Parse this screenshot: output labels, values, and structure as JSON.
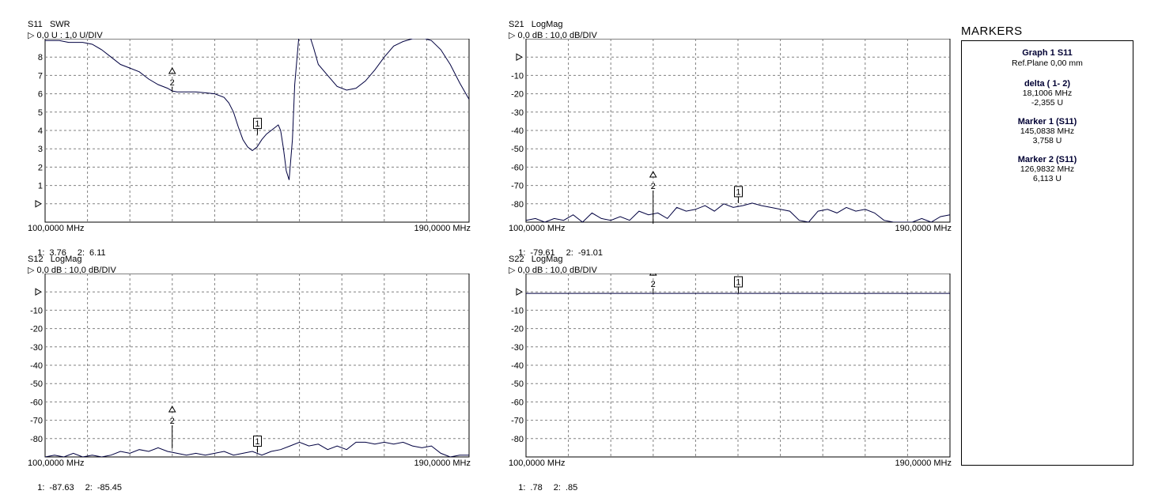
{
  "colors": {
    "trace": "#000040",
    "grid": "#808080",
    "ref_line": "#000060"
  },
  "chart_data": [
    {
      "id": "g1",
      "type": "line",
      "param": "S11",
      "format": "SWR",
      "scale_text": "0,0 U : 1,0 U/DIV",
      "x_start_label": "100,0000 MHz",
      "x_end_label": "190,0000 MHz",
      "xlim": [
        100,
        190
      ],
      "ylim": [
        -1,
        9
      ],
      "ref_value": 0,
      "y_ticks": [
        {
          "label": "8",
          "value": 8
        },
        {
          "label": "7",
          "value": 7
        },
        {
          "label": "6",
          "value": 6
        },
        {
          "label": "5",
          "value": 5
        },
        {
          "label": "4",
          "value": 4
        },
        {
          "label": "3",
          "value": 3
        },
        {
          "label": "2",
          "value": 2
        },
        {
          "label": "1",
          "value": 1
        }
      ],
      "series": [
        {
          "x": [
            100,
            103,
            105,
            108,
            110,
            112,
            114,
            116,
            118,
            120,
            122,
            124,
            126,
            127,
            128,
            130,
            132,
            134,
            136,
            138,
            139,
            140,
            141,
            142,
            143,
            144,
            145,
            146,
            147,
            148,
            149,
            149.5,
            150,
            150.6,
            151.2,
            151.8,
            152.5,
            153,
            154,
            155,
            156,
            157,
            158,
            160,
            162,
            164,
            166,
            168,
            170,
            172,
            174,
            176,
            178,
            180,
            182,
            184,
            186,
            188,
            190
          ],
          "y": [
            8.9,
            8.9,
            8.8,
            8.8,
            8.7,
            8.4,
            8.0,
            7.6,
            7.4,
            7.2,
            6.8,
            6.5,
            6.3,
            6.15,
            6.1,
            6.1,
            6.1,
            6.05,
            6.0,
            5.8,
            5.5,
            5.0,
            4.2,
            3.5,
            3.1,
            2.9,
            3.1,
            3.5,
            3.8,
            4.0,
            4.2,
            4.3,
            4.0,
            3.0,
            1.8,
            1.3,
            3.5,
            6.5,
            9.5,
            9.5,
            9.3,
            8.5,
            7.6,
            7.0,
            6.4,
            6.2,
            6.3,
            6.7,
            7.3,
            8.0,
            8.6,
            8.85,
            9.0,
            9.05,
            8.9,
            8.4,
            7.6,
            6.6,
            5.7
          ]
        }
      ],
      "markers": [
        {
          "id": "1",
          "x": 145.0838,
          "y": 3.758,
          "kind": "box"
        },
        {
          "id": "2",
          "x": 126.9832,
          "y": 6.113,
          "kind": "delta"
        }
      ],
      "readout": [
        {
          "label": "1:",
          "value": "3.76"
        },
        {
          "label": "2:",
          "value": "6.11"
        }
      ]
    },
    {
      "id": "g2",
      "type": "line",
      "param": "S21",
      "format": "LogMag",
      "scale_text": "0,0 dB : 10,0 dB/DIV",
      "x_start_label": "100,0000 MHz",
      "x_end_label": "190,0000 MHz",
      "xlim": [
        100,
        190
      ],
      "ylim": [
        -90,
        10
      ],
      "ref_value": 0,
      "y_ticks": [
        {
          "label": "-10",
          "value": -10
        },
        {
          "label": "-20",
          "value": -20
        },
        {
          "label": "-30",
          "value": -30
        },
        {
          "label": "-40",
          "value": -40
        },
        {
          "label": "-50",
          "value": -50
        },
        {
          "label": "-60",
          "value": -60
        },
        {
          "label": "-70",
          "value": -70
        },
        {
          "label": "-80",
          "value": -80
        }
      ],
      "series": [
        {
          "x": [
            100,
            102,
            104,
            106,
            108,
            110,
            112,
            114,
            116,
            118,
            120,
            122,
            124,
            126,
            128,
            130,
            132,
            134,
            136,
            138,
            140,
            142,
            144,
            146,
            148,
            150,
            152,
            154,
            156,
            158,
            160,
            162,
            164,
            166,
            168,
            170,
            172,
            174,
            176,
            178,
            180,
            182,
            184,
            186,
            188,
            190
          ],
          "y": [
            -89,
            -88,
            -90,
            -88,
            -89,
            -86,
            -90,
            -85,
            -88,
            -89,
            -87,
            -89,
            -84,
            -86,
            -85,
            -88,
            -82,
            -84,
            -83,
            -81,
            -84,
            -80,
            -82,
            -81,
            -79.6,
            -81,
            -82,
            -83,
            -84,
            -89,
            -90,
            -84,
            -83,
            -85,
            -82,
            -84,
            -83,
            -85,
            -89,
            -90,
            -90,
            -90,
            -88,
            -90,
            -87,
            -86
          ]
        }
      ],
      "markers": [
        {
          "id": "1",
          "x": 145.0838,
          "y": -79.61,
          "kind": "box"
        },
        {
          "id": "2",
          "x": 126.9832,
          "y": -91.01,
          "kind": "delta"
        }
      ],
      "readout": [
        {
          "label": "1:",
          "value": "-79.61"
        },
        {
          "label": "2:",
          "value": "-91.01"
        }
      ]
    },
    {
      "id": "g3",
      "type": "line",
      "param": "S12",
      "format": "LogMag",
      "scale_text": "0,0 dB : 10,0 dB/DIV",
      "x_start_label": "100,0000 MHz",
      "x_end_label": "190,0000 MHz",
      "xlim": [
        100,
        190
      ],
      "ylim": [
        -90,
        10
      ],
      "ref_value": 0,
      "y_ticks": [
        {
          "label": "-10",
          "value": -10
        },
        {
          "label": "-20",
          "value": -20
        },
        {
          "label": "-30",
          "value": -30
        },
        {
          "label": "-40",
          "value": -40
        },
        {
          "label": "-50",
          "value": -50
        },
        {
          "label": "-60",
          "value": -60
        },
        {
          "label": "-70",
          "value": -70
        },
        {
          "label": "-80",
          "value": -80
        }
      ],
      "series": [
        {
          "x": [
            100,
            102,
            104,
            106,
            108,
            110,
            112,
            114,
            116,
            118,
            120,
            122,
            124,
            126,
            128,
            130,
            132,
            134,
            136,
            138,
            140,
            142,
            144,
            146,
            148,
            150,
            152,
            154,
            156,
            158,
            160,
            162,
            164,
            166,
            168,
            170,
            172,
            174,
            176,
            178,
            180,
            182,
            184,
            186,
            188,
            190
          ],
          "y": [
            -90,
            -89,
            -90,
            -88,
            -90,
            -89,
            -90,
            -89,
            -87,
            -88,
            -86,
            -87,
            -85,
            -87,
            -88,
            -89,
            -88,
            -89,
            -88,
            -87,
            -89,
            -88,
            -87,
            -89,
            -87,
            -86,
            -84,
            -82,
            -84,
            -83,
            -86,
            -84,
            -86,
            -82,
            -82,
            -83,
            -82,
            -83,
            -82,
            -84,
            -85,
            -84,
            -88,
            -90,
            -89,
            -89
          ]
        }
      ],
      "markers": [
        {
          "id": "1",
          "x": 145.0838,
          "y": -87.63,
          "kind": "box"
        },
        {
          "id": "2",
          "x": 126.9832,
          "y": -85.45,
          "kind": "delta"
        }
      ],
      "readout": [
        {
          "label": "1:",
          "value": "-87.63"
        },
        {
          "label": "2:",
          "value": "-85.45"
        }
      ]
    },
    {
      "id": "g4",
      "type": "line",
      "param": "S22",
      "format": "LogMag",
      "scale_text": "0,0 dB : 10,0 dB/DIV",
      "x_start_label": "100,0000 MHz",
      "x_end_label": "190,0000 MHz",
      "xlim": [
        100,
        190
      ],
      "ylim": [
        -90,
        10
      ],
      "ref_value": 0,
      "y_ticks": [
        {
          "label": "-10",
          "value": -10
        },
        {
          "label": "-20",
          "value": -20
        },
        {
          "label": "-30",
          "value": -30
        },
        {
          "label": "-40",
          "value": -40
        },
        {
          "label": "-50",
          "value": -50
        },
        {
          "label": "-60",
          "value": -60
        },
        {
          "label": "-70",
          "value": -70
        },
        {
          "label": "-80",
          "value": -80
        }
      ],
      "series": [
        {
          "x": [
            100,
            190
          ],
          "y": [
            -0.8,
            -0.8
          ]
        }
      ],
      "markers": [
        {
          "id": "1",
          "x": 145.0838,
          "y": -0.78,
          "kind": "box"
        },
        {
          "id": "2",
          "x": 126.9832,
          "y": -0.85,
          "kind": "delta"
        }
      ],
      "readout": [
        {
          "label": "1:",
          "value": ".78"
        },
        {
          "label": "2:",
          "value": ".85"
        }
      ]
    }
  ],
  "markers_panel": {
    "title": "MARKERS",
    "graph": "Graph 1 S11",
    "ref_plane": "Ref.Plane 0,00 mm",
    "delta": {
      "label": "delta ( 1- 2)",
      "freq": "18,1006 MHz",
      "value": "-2,355 U"
    },
    "marker1": {
      "label": "Marker  1 (S11)",
      "freq": "145,0838 MHz",
      "value": "3,758 U"
    },
    "marker2": {
      "label": "Marker  2 (S11)",
      "freq": "126,9832 MHz",
      "value": "6,113 U"
    }
  }
}
